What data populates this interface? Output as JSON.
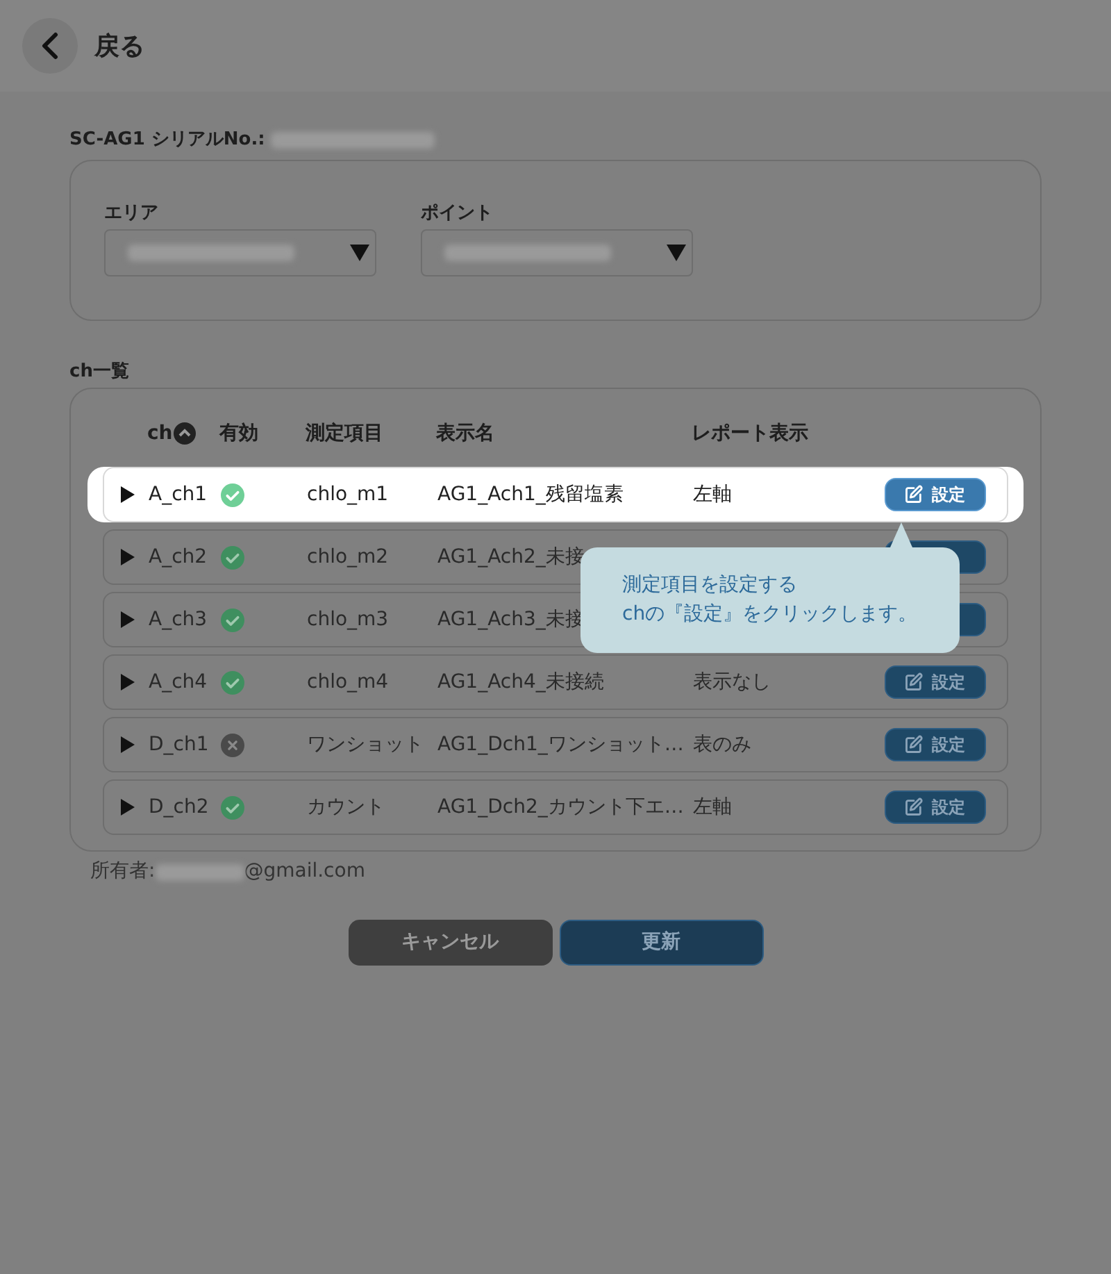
{
  "header": {
    "back_label": "戻る"
  },
  "serial_label": "SC-AG1 シリアルNo.:",
  "filters": [
    {
      "label": "エリア"
    },
    {
      "label": "ポイント"
    }
  ],
  "channel_list": {
    "title": "ch一覧",
    "columns": [
      "ch",
      "有効",
      "測定項目",
      "表示名",
      "レポート表示"
    ],
    "rows": [
      {
        "ch": "A_ch1",
        "enabled": true,
        "item": "chlo_m1",
        "display_name": "AG1_Ach1_残留塩素",
        "report": "左軸",
        "button_label": "設定",
        "selected": true
      },
      {
        "ch": "A_ch2",
        "enabled": true,
        "item": "chlo_m2",
        "display_name": "AG1_Ach2_未接",
        "selected": false
      },
      {
        "ch": "A_ch3",
        "enabled": true,
        "item": "chlo_m3",
        "display_name": "AG1_Ach3_未接",
        "selected": false
      },
      {
        "ch": "A_ch4",
        "enabled": true,
        "item": "chlo_m4",
        "display_name": "AG1_Ach4_未接続",
        "report": "表示なし",
        "button_label": "設定",
        "selected": false
      },
      {
        "ch": "D_ch1",
        "enabled": false,
        "item": "ワンショット",
        "display_name": "AG1_Dch1_ワンショット…",
        "report": "表のみ",
        "button_label": "設定",
        "selected": false
      },
      {
        "ch": "D_ch2",
        "enabled": true,
        "item": "カウント",
        "display_name": "AG1_Dch2_カウント下エ…",
        "report": "左軸",
        "button_label": "設定",
        "selected": false
      }
    ]
  },
  "tooltip": {
    "lines": [
      "測定項目を設定する",
      "chの『設定』をクリックします。"
    ]
  },
  "owner": {
    "label": "所有者:",
    "domain": "@gmail.com"
  },
  "buttons": {
    "cancel": "キャンセル",
    "update": "更新"
  }
}
